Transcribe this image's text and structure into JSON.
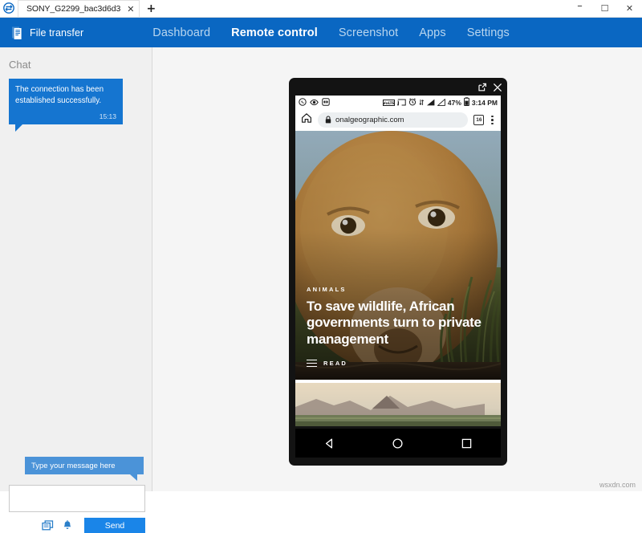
{
  "window": {
    "tab_label": "SONY_G2299_bac3d6d3",
    "tab_close_label": "✕",
    "new_tab_label": "+",
    "minimize_label": "–",
    "maximize_label": "☐",
    "close_label": "✕"
  },
  "header": {
    "brand_label": "File transfer",
    "brand_icon": "document-transfer-icon",
    "accent_color": "#0a67c2",
    "nav": [
      {
        "label": "Dashboard",
        "active": false
      },
      {
        "label": "Remote control",
        "active": true
      },
      {
        "label": "Screenshot",
        "active": false
      },
      {
        "label": "Apps",
        "active": false
      },
      {
        "label": "Settings",
        "active": false
      }
    ]
  },
  "sidebar": {
    "title": "Chat",
    "messages": [
      {
        "text": "The connection has been established successfully.",
        "time": "15:13",
        "bubble_color": "#1575d0"
      }
    ],
    "tooltip": "Type your message here",
    "input_value": "",
    "input_placeholder": "",
    "attach_icon": "screenshot-icon",
    "alert_icon": "bell-icon",
    "send_label": "Send",
    "send_color": "#1a85e8"
  },
  "phone": {
    "popout_icon": "open-external-icon",
    "close_icon": "close-icon",
    "status_bar": {
      "left_icons": [
        "whatsapp-icon",
        "eye-icon",
        "screen-mirror-icon"
      ],
      "right_icons": [
        "volte-icon",
        "cast-icon",
        "alarm-icon",
        "data-transfer-icon",
        "signal-bars-icon",
        "signal-bars-secondary-icon"
      ],
      "battery_percent": "47%",
      "battery_icon": "battery-icon",
      "clock": "3:14 PM"
    },
    "browser": {
      "home_icon": "home-icon",
      "lock_icon": "lock-icon",
      "url": "onalgeographic.com",
      "tab_count": "16",
      "menu_icon": "kebab-menu-icon"
    },
    "article": {
      "kicker": "ANIMALS",
      "headline": "To save wildlife, African governments turn to private management",
      "read_label": "READ"
    },
    "navigation": {
      "back_icon": "back-triangle-icon",
      "home_icon": "home-circle-icon",
      "recents_icon": "recents-square-icon"
    }
  },
  "watermark": "wsxdn.com"
}
